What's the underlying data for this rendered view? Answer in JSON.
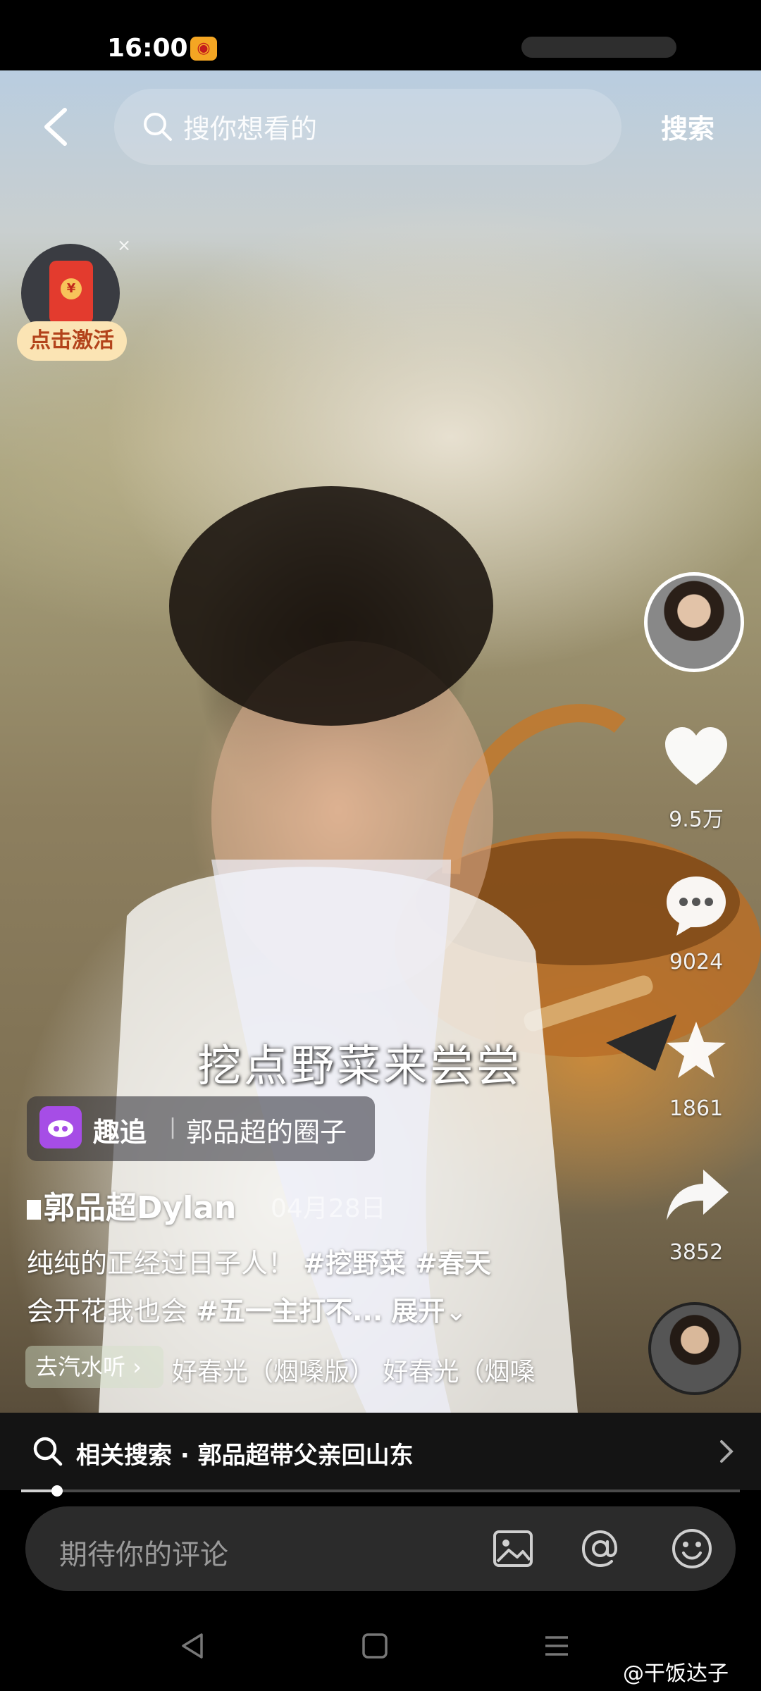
{
  "status_bar": {
    "time": "16:00"
  },
  "top_bar": {
    "search_placeholder": "搜你想看的",
    "search_button": "搜索"
  },
  "redpacket": {
    "button_label": "点击激活",
    "coin_symbol": "¥",
    "close_symbol": "×"
  },
  "side_rail": {
    "likes": "9.5万",
    "comments": "9024",
    "favorites": "1861",
    "shares": "3852"
  },
  "video_caption": "挖点野菜来尝尝",
  "tag": {
    "app_name": "趣追",
    "separator": "|",
    "circle_name": "郭品超的圈子"
  },
  "post": {
    "author": "郭品超Dylan",
    "date": "04月28日",
    "desc_line1_plain": "纯纯的正经过日子人！",
    "desc_line1_tags": "#挖野菜 #春天",
    "desc_line2_plain": "会开花我也会",
    "desc_line2_tags": "#五一主打不...",
    "expand_label": "展开"
  },
  "music": {
    "chip_label": "去汽水听",
    "title_scroll": "好春光（烟嗓版）   好春光（烟嗓"
  },
  "related": {
    "text": "相关搜索 · 郭品超带父亲回山东"
  },
  "progress": {
    "played_fraction": 0.05
  },
  "comment": {
    "placeholder": "期待你的评论"
  },
  "watermark": "@干饭达子"
}
